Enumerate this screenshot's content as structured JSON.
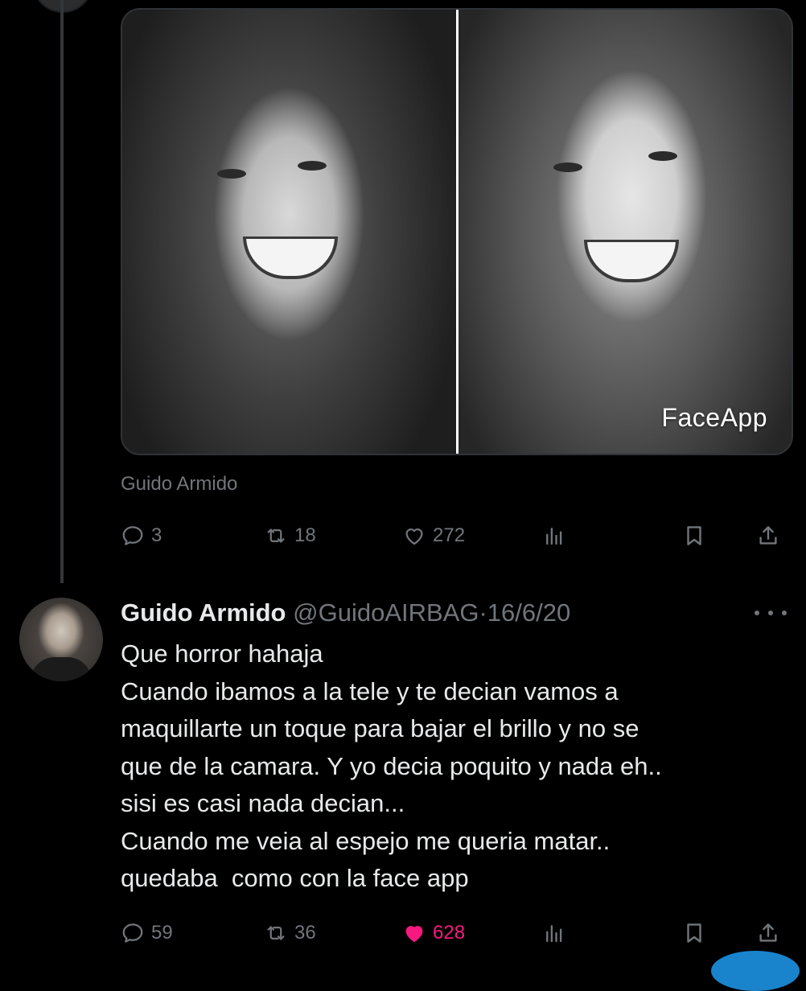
{
  "colors": {
    "background": "#000000",
    "text_primary": "#e7e9ea",
    "text_secondary": "#71767b",
    "like_active": "#f91880",
    "thread_line": "#333639",
    "accent": "#1d9bf0"
  },
  "post1": {
    "media": {
      "watermark": "FaceApp",
      "left_icon": "photo-before",
      "right_icon": "photo-after"
    },
    "attribution": "Guido Armido",
    "actions": {
      "replies": "3",
      "retweets": "18",
      "likes": "272",
      "liked": false
    }
  },
  "post2": {
    "display_name": "Guido Armido",
    "handle": "@GuidoAIRBAG",
    "separator": "·",
    "date": "16/6/20",
    "body_lines": [
      "Que horror hahaja",
      "Cuando ibamos a la tele y te decian vamos a",
      "maquillarte un toque para bajar el brillo y no se",
      "que de la camara. Y yo decia poquito y nada eh..",
      "sisi es casi nada decian...",
      "Cuando me veia al espejo me queria matar..",
      "quedaba  como con la face app"
    ],
    "actions": {
      "replies": "59",
      "retweets": "36",
      "likes": "628",
      "liked": true
    }
  },
  "icons": {
    "reply": "reply-icon",
    "retweet": "retweet-icon",
    "like": "heart-icon",
    "views": "analytics-icon",
    "bookmark": "bookmark-icon",
    "share": "share-icon",
    "more": "more-icon"
  }
}
